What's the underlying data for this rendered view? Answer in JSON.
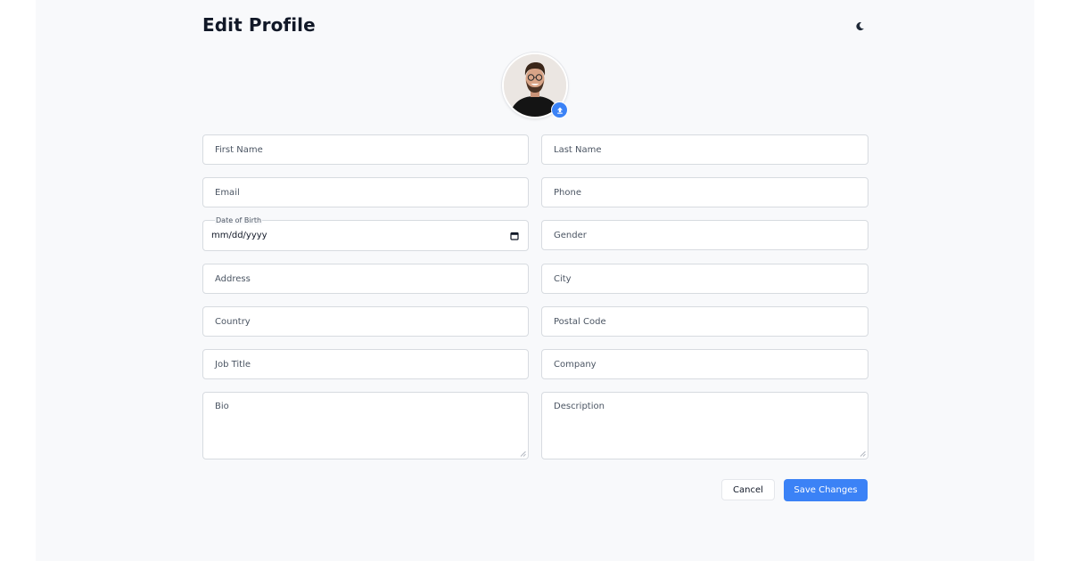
{
  "header": {
    "title": "Edit Profile",
    "theme_toggle_icon": "moon-icon"
  },
  "avatar": {
    "upload_icon": "upload-icon",
    "accent": "#3b82f6"
  },
  "form": {
    "first_name": {
      "placeholder": "First Name"
    },
    "last_name": {
      "placeholder": "Last Name"
    },
    "email": {
      "placeholder": "Email"
    },
    "phone": {
      "placeholder": "Phone"
    },
    "dob": {
      "label": "Date of Birth",
      "value": "mm/dd/yyyy",
      "icon": "calendar-icon"
    },
    "gender": {
      "placeholder": "Gender"
    },
    "address": {
      "placeholder": "Address"
    },
    "city": {
      "placeholder": "City"
    },
    "country": {
      "placeholder": "Country"
    },
    "postal_code": {
      "placeholder": "Postal Code"
    },
    "job_title": {
      "placeholder": "Job Title"
    },
    "company": {
      "placeholder": "Company"
    },
    "bio": {
      "placeholder": "Bio"
    },
    "description": {
      "placeholder": "Description"
    }
  },
  "actions": {
    "cancel_label": "Cancel",
    "save_label": "Save Changes"
  }
}
